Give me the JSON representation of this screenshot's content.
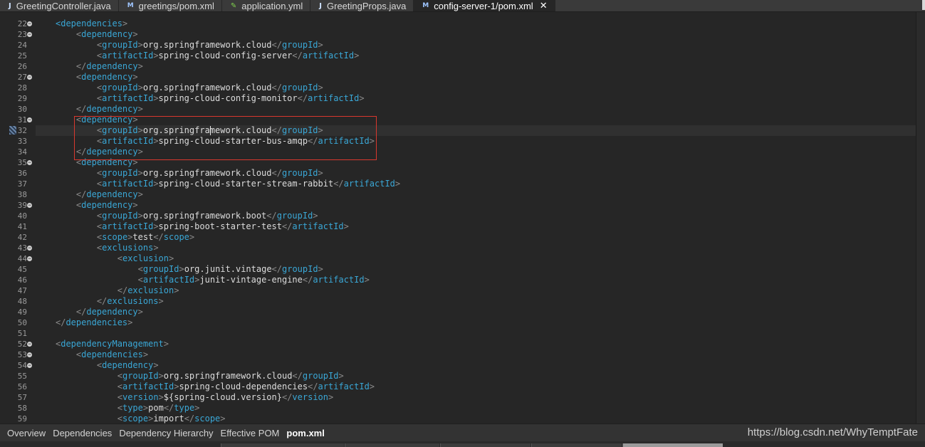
{
  "tabs": [
    {
      "label": "GreetingController.java",
      "icon": "java-file-icon",
      "glyph": "J",
      "kind": "java"
    },
    {
      "label": "greetings/pom.xml",
      "icon": "maven-pom-icon",
      "glyph": "M",
      "kind": "mvn"
    },
    {
      "label": "application.yml",
      "icon": "yaml-file-icon",
      "glyph": "✎",
      "kind": "yml"
    },
    {
      "label": "GreetingProps.java",
      "icon": "java-file-icon",
      "glyph": "J",
      "kind": "java"
    },
    {
      "label": "config-server-1/pom.xml",
      "icon": "maven-pom-icon",
      "glyph": "M",
      "kind": "mvn",
      "active": true,
      "close_glyph": "✕"
    }
  ],
  "editor": {
    "current_line": 32,
    "caret_line": 32,
    "caret_col": 22,
    "breakpoint_line": 32,
    "highlight_lines": [
      31,
      34
    ],
    "lines": [
      {
        "n": 22,
        "fold": true,
        "indent": 1,
        "parts": [
          [
            "t",
            "<dependencies"
          ],
          [
            "b",
            ">"
          ]
        ]
      },
      {
        "n": 23,
        "fold": true,
        "indent": 2,
        "parts": [
          [
            "b",
            "<"
          ],
          [
            "t",
            "dependency"
          ],
          [
            "b",
            ">"
          ]
        ]
      },
      {
        "n": 24,
        "indent": 3,
        "parts": [
          [
            "b",
            "<"
          ],
          [
            "t",
            "groupId"
          ],
          [
            "b",
            ">"
          ],
          [
            "x",
            "org.springframework.cloud"
          ],
          [
            "b",
            "</"
          ],
          [
            "t",
            "groupId"
          ],
          [
            "b",
            ">"
          ]
        ]
      },
      {
        "n": 25,
        "indent": 3,
        "parts": [
          [
            "b",
            "<"
          ],
          [
            "t",
            "artifactId"
          ],
          [
            "b",
            ">"
          ],
          [
            "x",
            "spring-cloud-config-server"
          ],
          [
            "b",
            "</"
          ],
          [
            "t",
            "artifactId"
          ],
          [
            "b",
            ">"
          ]
        ]
      },
      {
        "n": 26,
        "indent": 2,
        "parts": [
          [
            "b",
            "</"
          ],
          [
            "t",
            "dependency"
          ],
          [
            "b",
            ">"
          ]
        ]
      },
      {
        "n": 27,
        "fold": true,
        "indent": 2,
        "parts": [
          [
            "b",
            "<"
          ],
          [
            "t",
            "dependency"
          ],
          [
            "b",
            ">"
          ]
        ]
      },
      {
        "n": 28,
        "indent": 3,
        "parts": [
          [
            "b",
            "<"
          ],
          [
            "t",
            "groupId"
          ],
          [
            "b",
            ">"
          ],
          [
            "x",
            "org.springframework.cloud"
          ],
          [
            "b",
            "</"
          ],
          [
            "t",
            "groupId"
          ],
          [
            "b",
            ">"
          ]
        ]
      },
      {
        "n": 29,
        "indent": 3,
        "parts": [
          [
            "b",
            "<"
          ],
          [
            "t",
            "artifactId"
          ],
          [
            "b",
            ">"
          ],
          [
            "x",
            "spring-cloud-config-monitor"
          ],
          [
            "b",
            "</"
          ],
          [
            "t",
            "artifactId"
          ],
          [
            "b",
            ">"
          ]
        ]
      },
      {
        "n": 30,
        "indent": 2,
        "parts": [
          [
            "b",
            "</"
          ],
          [
            "t",
            "dependency"
          ],
          [
            "b",
            ">"
          ]
        ]
      },
      {
        "n": 31,
        "fold": true,
        "indent": 2,
        "parts": [
          [
            "b",
            "<"
          ],
          [
            "t",
            "dependency"
          ],
          [
            "b",
            ">"
          ]
        ]
      },
      {
        "n": 32,
        "indent": 3,
        "parts": [
          [
            "b",
            "<"
          ],
          [
            "t",
            "groupId"
          ],
          [
            "b",
            ">"
          ],
          [
            "x",
            "org.springframework.cloud"
          ],
          [
            "b",
            "</"
          ],
          [
            "t",
            "groupId"
          ],
          [
            "b",
            ">"
          ]
        ]
      },
      {
        "n": 33,
        "indent": 3,
        "parts": [
          [
            "b",
            "<"
          ],
          [
            "t",
            "artifactId"
          ],
          [
            "b",
            ">"
          ],
          [
            "x",
            "spring-cloud-starter-bus-amqp"
          ],
          [
            "b",
            "</"
          ],
          [
            "t",
            "artifactId"
          ],
          [
            "b",
            ">"
          ]
        ]
      },
      {
        "n": 34,
        "indent": 2,
        "parts": [
          [
            "b",
            "</"
          ],
          [
            "t",
            "dependency"
          ],
          [
            "b",
            ">"
          ]
        ]
      },
      {
        "n": 35,
        "fold": true,
        "indent": 2,
        "parts": [
          [
            "b",
            "<"
          ],
          [
            "t",
            "dependency"
          ],
          [
            "b",
            ">"
          ]
        ]
      },
      {
        "n": 36,
        "indent": 3,
        "parts": [
          [
            "b",
            "<"
          ],
          [
            "t",
            "groupId"
          ],
          [
            "b",
            ">"
          ],
          [
            "x",
            "org.springframework.cloud"
          ],
          [
            "b",
            "</"
          ],
          [
            "t",
            "groupId"
          ],
          [
            "b",
            ">"
          ]
        ]
      },
      {
        "n": 37,
        "indent": 3,
        "parts": [
          [
            "b",
            "<"
          ],
          [
            "t",
            "artifactId"
          ],
          [
            "b",
            ">"
          ],
          [
            "x",
            "spring-cloud-starter-stream-rabbit"
          ],
          [
            "b",
            "</"
          ],
          [
            "t",
            "artifactId"
          ],
          [
            "b",
            ">"
          ]
        ]
      },
      {
        "n": 38,
        "indent": 2,
        "parts": [
          [
            "b",
            "</"
          ],
          [
            "t",
            "dependency"
          ],
          [
            "b",
            ">"
          ]
        ]
      },
      {
        "n": 39,
        "fold": true,
        "indent": 2,
        "parts": [
          [
            "b",
            "<"
          ],
          [
            "t",
            "dependency"
          ],
          [
            "b",
            ">"
          ]
        ]
      },
      {
        "n": 40,
        "indent": 3,
        "parts": [
          [
            "b",
            "<"
          ],
          [
            "t",
            "groupId"
          ],
          [
            "b",
            ">"
          ],
          [
            "x",
            "org.springframework.boot"
          ],
          [
            "b",
            "</"
          ],
          [
            "t",
            "groupId"
          ],
          [
            "b",
            ">"
          ]
        ]
      },
      {
        "n": 41,
        "indent": 3,
        "parts": [
          [
            "b",
            "<"
          ],
          [
            "t",
            "artifactId"
          ],
          [
            "b",
            ">"
          ],
          [
            "x",
            "spring-boot-starter-test"
          ],
          [
            "b",
            "</"
          ],
          [
            "t",
            "artifactId"
          ],
          [
            "b",
            ">"
          ]
        ]
      },
      {
        "n": 42,
        "indent": 3,
        "parts": [
          [
            "b",
            "<"
          ],
          [
            "t",
            "scope"
          ],
          [
            "b",
            ">"
          ],
          [
            "x",
            "test"
          ],
          [
            "b",
            "</"
          ],
          [
            "t",
            "scope"
          ],
          [
            "b",
            ">"
          ]
        ]
      },
      {
        "n": 43,
        "fold": true,
        "indent": 3,
        "parts": [
          [
            "b",
            "<"
          ],
          [
            "t",
            "exclusions"
          ],
          [
            "b",
            ">"
          ]
        ]
      },
      {
        "n": 44,
        "fold": true,
        "indent": 4,
        "parts": [
          [
            "b",
            "<"
          ],
          [
            "t",
            "exclusion"
          ],
          [
            "b",
            ">"
          ]
        ]
      },
      {
        "n": 45,
        "indent": 5,
        "parts": [
          [
            "b",
            "<"
          ],
          [
            "t",
            "groupId"
          ],
          [
            "b",
            ">"
          ],
          [
            "x",
            "org.junit.vintage"
          ],
          [
            "b",
            "</"
          ],
          [
            "t",
            "groupId"
          ],
          [
            "b",
            ">"
          ]
        ]
      },
      {
        "n": 46,
        "indent": 5,
        "parts": [
          [
            "b",
            "<"
          ],
          [
            "t",
            "artifactId"
          ],
          [
            "b",
            ">"
          ],
          [
            "x",
            "junit-vintage-engine"
          ],
          [
            "b",
            "</"
          ],
          [
            "t",
            "artifactId"
          ],
          [
            "b",
            ">"
          ]
        ]
      },
      {
        "n": 47,
        "indent": 4,
        "parts": [
          [
            "b",
            "</"
          ],
          [
            "t",
            "exclusion"
          ],
          [
            "b",
            ">"
          ]
        ]
      },
      {
        "n": 48,
        "indent": 3,
        "parts": [
          [
            "b",
            "</"
          ],
          [
            "t",
            "exclusions"
          ],
          [
            "b",
            ">"
          ]
        ]
      },
      {
        "n": 49,
        "indent": 2,
        "parts": [
          [
            "b",
            "</"
          ],
          [
            "t",
            "dependency"
          ],
          [
            "b",
            ">"
          ]
        ]
      },
      {
        "n": 50,
        "indent": 1,
        "parts": [
          [
            "b",
            "</"
          ],
          [
            "t",
            "dependencies"
          ],
          [
            "b",
            ">"
          ]
        ]
      },
      {
        "n": 51,
        "indent": 0,
        "parts": []
      },
      {
        "n": 52,
        "fold": true,
        "indent": 1,
        "parts": [
          [
            "b",
            "<"
          ],
          [
            "t",
            "dependencyManagement"
          ],
          [
            "b",
            ">"
          ]
        ]
      },
      {
        "n": 53,
        "fold": true,
        "indent": 2,
        "parts": [
          [
            "b",
            "<"
          ],
          [
            "t",
            "dependencies"
          ],
          [
            "b",
            ">"
          ]
        ]
      },
      {
        "n": 54,
        "fold": true,
        "indent": 3,
        "parts": [
          [
            "b",
            "<"
          ],
          [
            "t",
            "dependency"
          ],
          [
            "b",
            ">"
          ]
        ]
      },
      {
        "n": 55,
        "indent": 4,
        "parts": [
          [
            "b",
            "<"
          ],
          [
            "t",
            "groupId"
          ],
          [
            "b",
            ">"
          ],
          [
            "x",
            "org.springframework.cloud"
          ],
          [
            "b",
            "</"
          ],
          [
            "t",
            "groupId"
          ],
          [
            "b",
            ">"
          ]
        ]
      },
      {
        "n": 56,
        "indent": 4,
        "parts": [
          [
            "b",
            "<"
          ],
          [
            "t",
            "artifactId"
          ],
          [
            "b",
            ">"
          ],
          [
            "x",
            "spring-cloud-dependencies"
          ],
          [
            "b",
            "</"
          ],
          [
            "t",
            "artifactId"
          ],
          [
            "b",
            ">"
          ]
        ]
      },
      {
        "n": 57,
        "indent": 4,
        "parts": [
          [
            "b",
            "<"
          ],
          [
            "t",
            "version"
          ],
          [
            "b",
            ">"
          ],
          [
            "x",
            "${spring-cloud.version}"
          ],
          [
            "b",
            "</"
          ],
          [
            "t",
            "version"
          ],
          [
            "b",
            ">"
          ]
        ]
      },
      {
        "n": 58,
        "indent": 4,
        "parts": [
          [
            "b",
            "<"
          ],
          [
            "t",
            "type"
          ],
          [
            "b",
            ">"
          ],
          [
            "x",
            "pom"
          ],
          [
            "b",
            "</"
          ],
          [
            "t",
            "type"
          ],
          [
            "b",
            ">"
          ]
        ]
      },
      {
        "n": 59,
        "indent": 4,
        "parts": [
          [
            "b",
            "<"
          ],
          [
            "t",
            "scope"
          ],
          [
            "b",
            ">"
          ],
          [
            "x",
            "import"
          ],
          [
            "b",
            "</"
          ],
          [
            "t",
            "scope"
          ],
          [
            "b",
            ">"
          ]
        ]
      }
    ]
  },
  "bottom_tabs": [
    {
      "label": "Overview"
    },
    {
      "label": "Dependencies"
    },
    {
      "label": "Dependency Hierarchy"
    },
    {
      "label": "Effective POM"
    },
    {
      "label": "pom.xml",
      "active": true
    }
  ],
  "watermark": "https://blog.csdn.net/WhyTemptFate",
  "colors": {
    "tag": "#3aa7d6",
    "bracket": "#8a8a8a",
    "text": "#dcdcdc",
    "background": "#262626",
    "highlight_box": "#d9382e"
  }
}
